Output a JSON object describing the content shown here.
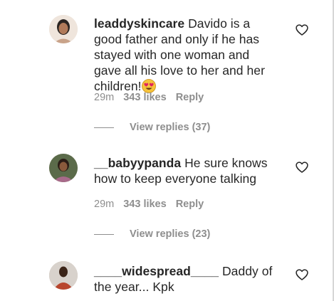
{
  "comments": [
    {
      "username": "leaddyskincare",
      "text": "Davido is a good father and only if he has stayed with one woman and gave all his love to her and her children!",
      "emoji": "heart-eyes-emoji",
      "time": "29m",
      "likes": "343 likes",
      "reply": "Reply",
      "view_replies": "View replies (37)"
    },
    {
      "username": "__babyypanda",
      "text": "He sure knows how to keep everyone talking",
      "time": "29m",
      "likes": "343 likes",
      "reply": "Reply",
      "view_replies": "View replies (23)"
    },
    {
      "username": "____widespread____",
      "text": "Daddy of the year... Kpk"
    }
  ],
  "icons": {
    "like": "heart-outline-icon"
  },
  "colors": {
    "text": "#262626",
    "muted": "#8e8e8e",
    "emoji_face": "#f5c33b",
    "emoji_eyes": "#e0245e"
  }
}
